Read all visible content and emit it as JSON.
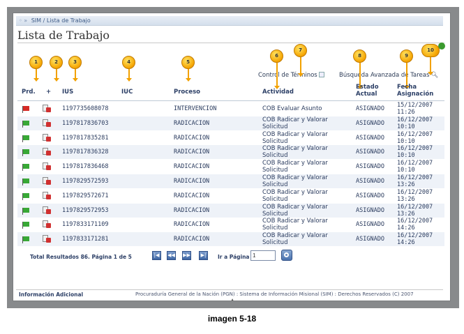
{
  "breadcrumb": "SIM / Lista de Trabajo",
  "page_title": "Lista de Trabajo",
  "links": {
    "control_terminos": "Control de Términos",
    "busqueda_avanzada": "Búsqueda Avanzada de Tareas"
  },
  "callouts": [
    "1",
    "2",
    "3",
    "4",
    "5",
    "6",
    "7",
    "8",
    "9",
    "10"
  ],
  "columns": {
    "prd": "Prd.",
    "plus": "+",
    "ius": "IUS",
    "iuc": "IUC",
    "proceso": "Proceso",
    "actividad": "Actividad",
    "estado_line1": "Estado",
    "estado_line2": "Actual",
    "fecha_line1": "Fecha",
    "fecha_line2": "Asignación"
  },
  "rows": [
    {
      "flag": "red",
      "ius": "1197735608078",
      "iuc": "",
      "proceso": "INTERVENCION",
      "act1": "COB Evaluar Asunto",
      "act2": "",
      "estado": "ASIGNADO",
      "fecha": "15/12/2007",
      "hora": "11:26"
    },
    {
      "flag": "green",
      "ius": "1197817836703",
      "iuc": "",
      "proceso": "RADICACION",
      "act1": "COB Radicar y Valorar",
      "act2": "Solicitud",
      "estado": "ASIGNADO",
      "fecha": "16/12/2007",
      "hora": "10:10"
    },
    {
      "flag": "green",
      "ius": "1197817835281",
      "iuc": "",
      "proceso": "RADICACION",
      "act1": "COB Radicar y Valorar",
      "act2": "Solicitud",
      "estado": "ASIGNADO",
      "fecha": "16/12/2007",
      "hora": "10:10"
    },
    {
      "flag": "green",
      "ius": "1197817836328",
      "iuc": "",
      "proceso": "RADICACION",
      "act1": "COB Radicar y Valorar",
      "act2": "Solicitud",
      "estado": "ASIGNADO",
      "fecha": "16/12/2007",
      "hora": "10:10"
    },
    {
      "flag": "green",
      "ius": "1197817836468",
      "iuc": "",
      "proceso": "RADICACION",
      "act1": "COB Radicar y Valorar",
      "act2": "Solicitud",
      "estado": "ASIGNADO",
      "fecha": "16/12/2007",
      "hora": "10:10"
    },
    {
      "flag": "green",
      "ius": "1197829572593",
      "iuc": "",
      "proceso": "RADICACION",
      "act1": "COB Radicar y Valorar",
      "act2": "Solicitud",
      "estado": "ASIGNADO",
      "fecha": "16/12/2007",
      "hora": "13:26"
    },
    {
      "flag": "green",
      "ius": "1197829572671",
      "iuc": "",
      "proceso": "RADICACION",
      "act1": "COB Radicar y Valorar",
      "act2": "Solicitud",
      "estado": "ASIGNADO",
      "fecha": "16/12/2007",
      "hora": "13:26"
    },
    {
      "flag": "green",
      "ius": "1197829572953",
      "iuc": "",
      "proceso": "RADICACION",
      "act1": "COB Radicar y Valorar",
      "act2": "Solicitud",
      "estado": "ASIGNADO",
      "fecha": "16/12/2007",
      "hora": "13:26"
    },
    {
      "flag": "green",
      "ius": "1197833171109",
      "iuc": "",
      "proceso": "RADICACION",
      "act1": "COB Radicar y Valorar",
      "act2": "Solicitud",
      "estado": "ASIGNADO",
      "fecha": "16/12/2007",
      "hora": "14:26"
    },
    {
      "flag": "green",
      "ius": "1197833171281",
      "iuc": "",
      "proceso": "RADICACION",
      "act1": "COB Radicar y Valorar",
      "act2": "Solicitud",
      "estado": "ASIGNADO",
      "fecha": "16/12/2007",
      "hora": "14:26"
    }
  ],
  "pager": {
    "summary": "Total Resultados 86. Página 1 de 5",
    "first": "|◀",
    "prev": "◀◀",
    "next": "▶▶",
    "last": "▶|",
    "goto_label": "Ir a Página",
    "goto_value": "1"
  },
  "footer": {
    "left": "Información Adicional",
    "right": "Procuraduría General de la Nación (PGN) : Sistema de Información Misional (SIM) : Derechos Reservados (C) 2007"
  },
  "caption": "imagen 5-18",
  "colors": {
    "accent": "#2c3f66",
    "flag_red": "#d62a25",
    "flag_green": "#38a836",
    "callout": "#f5a400",
    "row_alt": "#eef2f8"
  }
}
